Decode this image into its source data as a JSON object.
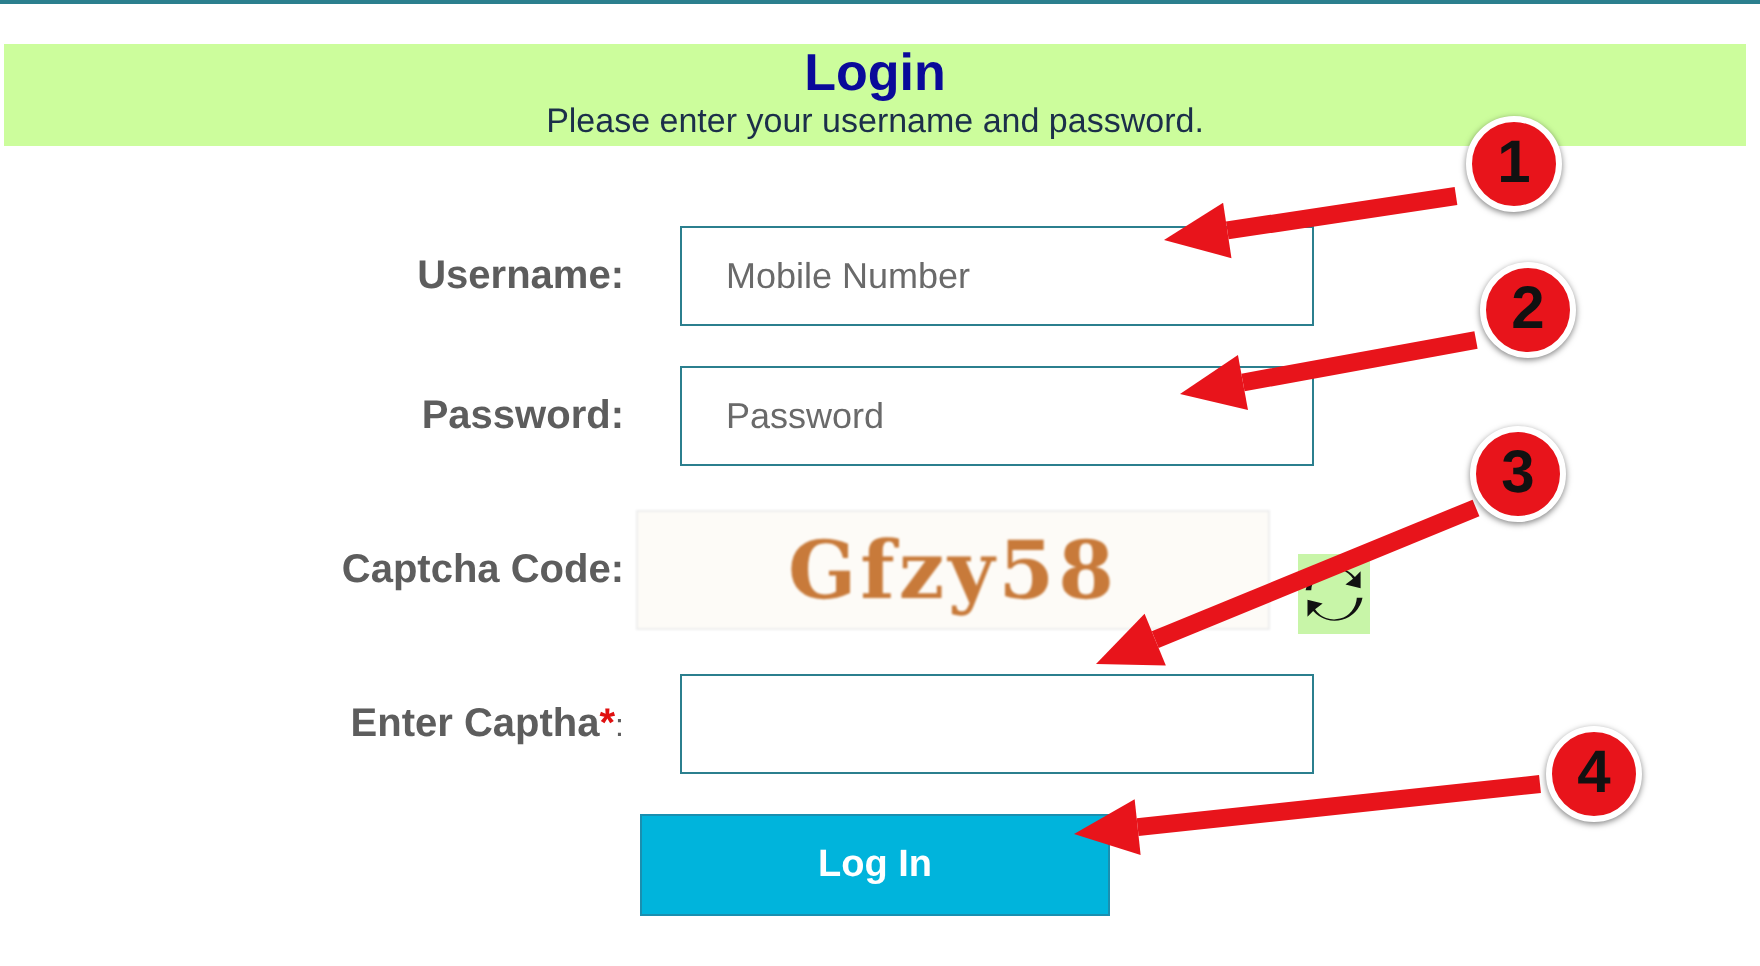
{
  "header": {
    "title": "Login",
    "subtitle": "Please enter your username and password."
  },
  "form": {
    "fields": [
      {
        "kind": "input",
        "label": "Username:",
        "placeholder": "Mobile Number"
      },
      {
        "kind": "input",
        "label": "Password:",
        "placeholder": "Password"
      },
      {
        "kind": "captcha",
        "label": "Captcha Code:",
        "captcha_text": "Gfzy58"
      },
      {
        "kind": "input",
        "label": "Enter Captha",
        "required_mark": "*",
        "colon": ":"
      }
    ],
    "submit": "Log In"
  },
  "annotations": [
    {
      "number": "1",
      "color": "#e8141b"
    },
    {
      "number": "2",
      "color": "#e8141b"
    },
    {
      "number": "3",
      "color": "#e8141b"
    },
    {
      "number": "4",
      "color": "#e8141b"
    }
  ]
}
